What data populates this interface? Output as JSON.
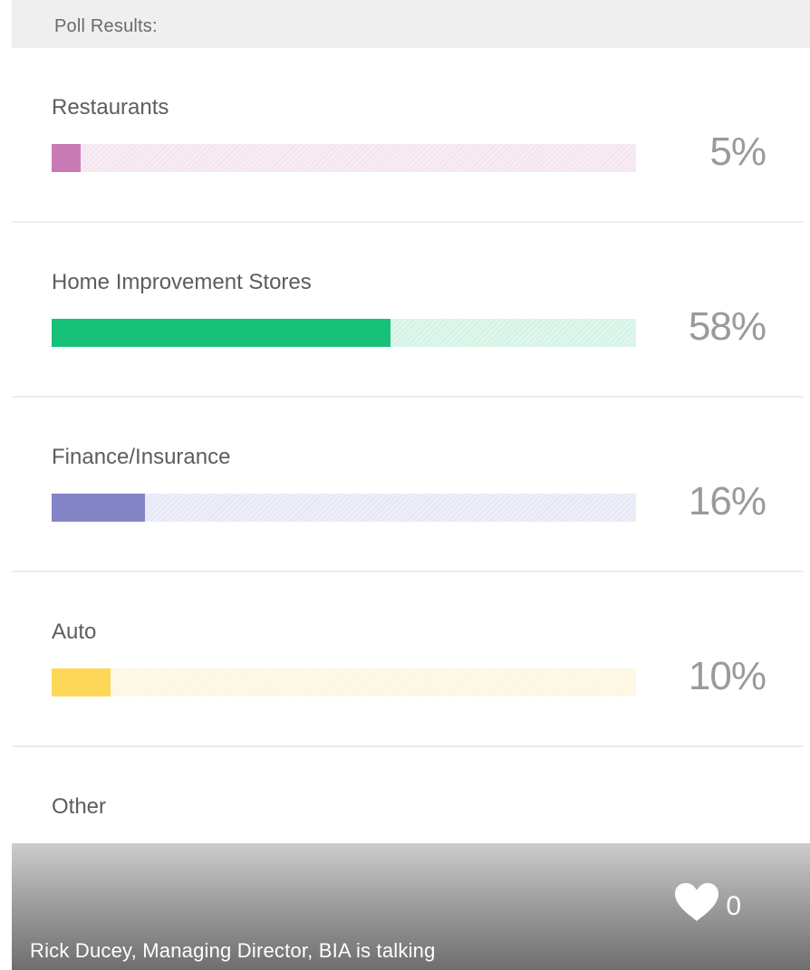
{
  "header": {
    "title": "Poll Results:"
  },
  "poll": {
    "items": [
      {
        "label": "Restaurants",
        "percent_label": "5%",
        "value": 0.05,
        "fill_color": "#c97ab6",
        "track_color": "#f5e4f0"
      },
      {
        "label": "Home Improvement Stores",
        "percent_label": "58%",
        "value": 0.58,
        "fill_color": "#18c17a",
        "track_color": "#d3f3e5"
      },
      {
        "label": "Finance/Insurance",
        "percent_label": "16%",
        "value": 0.16,
        "fill_color": "#8385c6",
        "track_color": "#e6e7f6"
      },
      {
        "label": "Auto",
        "percent_label": "10%",
        "value": 0.1,
        "fill_color": "#fdd858",
        "track_color": "#fdf6df"
      },
      {
        "label": "Other",
        "percent_label": "",
        "value": null,
        "fill_color": "",
        "track_color": ""
      }
    ]
  },
  "footer": {
    "like_count": "0",
    "heart_icon": "heart-icon",
    "caption": "Rick Ducey, Managing Director, BIA is talking"
  }
}
